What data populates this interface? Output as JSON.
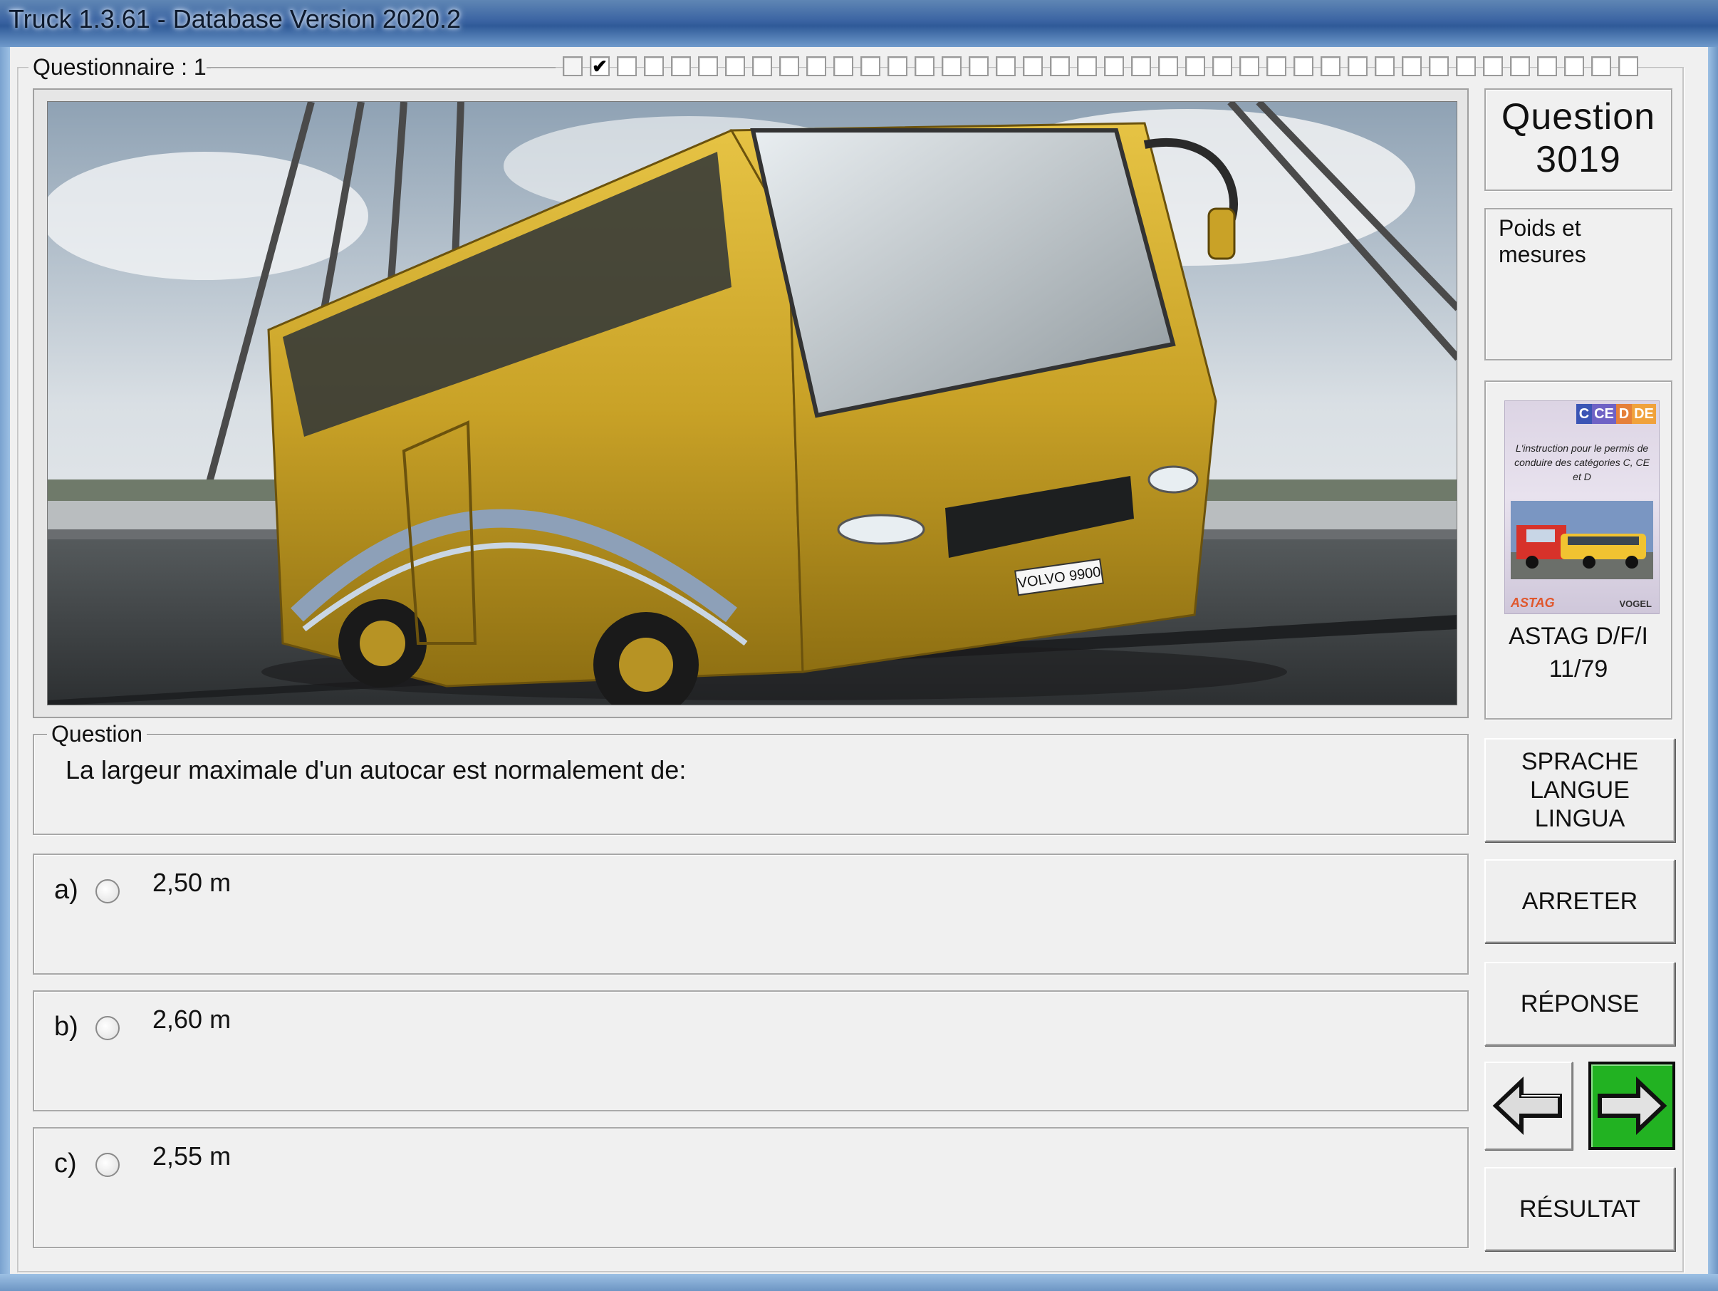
{
  "window": {
    "title": "Truck 1.3.61 - Database Version 2020.2"
  },
  "questionnaire": {
    "label": "Questionnaire : 1",
    "checkmark": "✔"
  },
  "image": {
    "subject": "bus-photo",
    "plate_text": "VOLVO 9900"
  },
  "question": {
    "group_label": "Question",
    "text": "La largeur maximale d'un autocar est normalement de:"
  },
  "answers": [
    {
      "letter": "a)",
      "text": "2,50 m"
    },
    {
      "letter": "b)",
      "text": "2,60 m"
    },
    {
      "letter": "c)",
      "text": "2,55 m"
    }
  ],
  "sidebar": {
    "question_label": "Question",
    "question_number": "3019",
    "category": "Poids et mesures",
    "book": {
      "cover_tags": [
        "C",
        "CE",
        "D",
        "DE"
      ],
      "cover_text": "L'instruction pour le permis de conduire des catégories C, CE et D",
      "cover_brand_left": "ASTAG",
      "cover_brand_right": "VOGEL",
      "label": "ASTAG D/F/I",
      "page": "11/79"
    },
    "buttons": {
      "language_lines": [
        "SPRACHE",
        "LANGUE",
        "LINGUA"
      ],
      "stop": "ARRETER",
      "answer": "RÉPONSE",
      "result": "RÉSULTAT"
    }
  },
  "colors": {
    "next_button": "#22b222",
    "bus_body": "#c9a227",
    "titlebar": "#3a63a2"
  },
  "icons": {
    "prev": "arrow-left-icon",
    "next": "arrow-right-icon"
  }
}
